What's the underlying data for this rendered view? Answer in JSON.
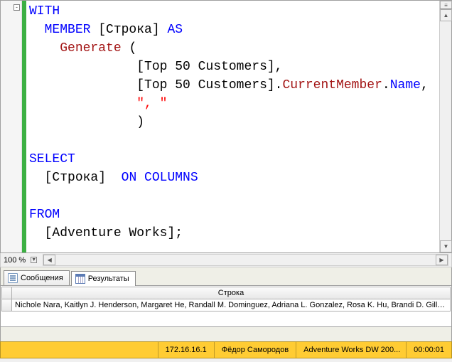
{
  "editor": {
    "collapse_glyph": "-",
    "code": {
      "l1_kw": "WITH",
      "l2_kw_member": "MEMBER",
      "l2_ident": " [Строка] ",
      "l2_kw_as": "AS",
      "l3_gen": "Generate ",
      "l3_paren": "(",
      "l4": "[Top 50 Customers],",
      "l5_a": "[Top 50 Customers].",
      "l5_b": "CurrentMember",
      "l5_c": ".",
      "l5_d": "Name",
      "l5_e": ",",
      "l6": "\", \"",
      "l7": ")",
      "l8_kw": "SELECT",
      "l9_a": "[Строка]  ",
      "l9_b": "ON COLUMNS",
      "l10_kw": "FROM",
      "l11": "[Adventure Works];"
    }
  },
  "zoom": {
    "level": "100 %"
  },
  "tabs": {
    "messages": "Сообщения",
    "results": "Результаты"
  },
  "grid": {
    "header": "Строка",
    "row1": "Nichole Nara, Kaitlyn J. Henderson, Margaret He, Randall M. Dominguez, Adriana L. Gonzalez, Rosa K. Hu, Brandi D. Gill, B..."
  },
  "status": {
    "ip": "172.16.16.1",
    "user": "Фёдор Самородов",
    "db": "Adventure Works DW 200...",
    "time": "00:00:01"
  }
}
